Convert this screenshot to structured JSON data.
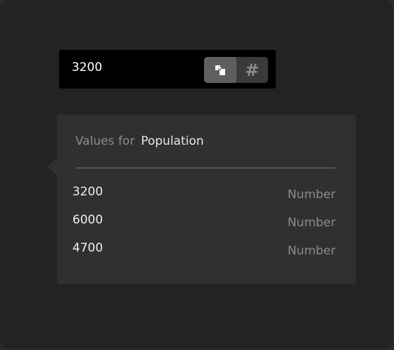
{
  "input": {
    "value": "3200",
    "toggles": [
      {
        "icon": "link-icon",
        "active": true
      },
      {
        "icon": "hash-icon",
        "label": "#",
        "active": false
      }
    ]
  },
  "popover": {
    "prefix": "Values for",
    "field": "Population",
    "rows": [
      {
        "value": "3200",
        "type": "Number"
      },
      {
        "value": "6000",
        "type": "Number"
      },
      {
        "value": "4700",
        "type": "Number"
      }
    ]
  },
  "colors": {
    "background": "#232323",
    "input_bg": "#000000",
    "popover_bg": "#303030",
    "toggle_active": "#5f5f5f",
    "muted_text": "#8a8a8a"
  }
}
